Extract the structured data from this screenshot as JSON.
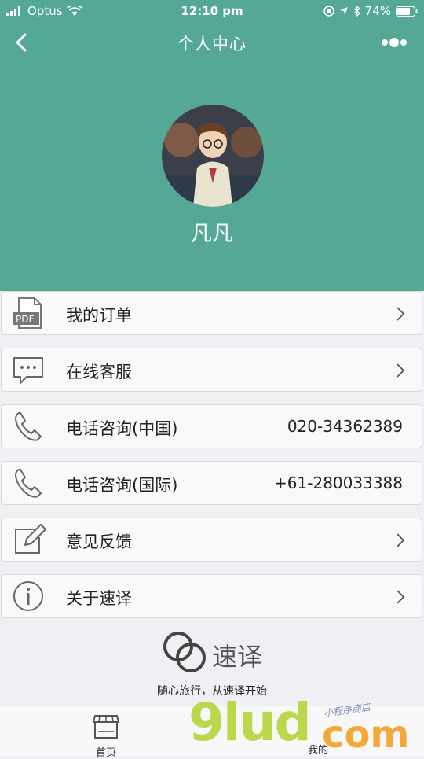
{
  "status_bar": {
    "carrier": "Optus",
    "time": "12:10 pm",
    "battery": "74%"
  },
  "nav": {
    "title": "个人中心"
  },
  "profile": {
    "name": "凡凡"
  },
  "menu": {
    "items": [
      {
        "label": "我的订单",
        "icon": "pdf-document-icon"
      },
      {
        "label": "在线客服",
        "icon": "chat-bubble-icon"
      },
      {
        "label": "电话咨询(中国)",
        "value": "020-34362389",
        "icon": "phone-icon"
      },
      {
        "label": "电话咨询(国际)",
        "value": "+61-280033388",
        "icon": "phone-icon"
      },
      {
        "label": "意见反馈",
        "icon": "edit-icon"
      },
      {
        "label": "关于速译",
        "icon": "info-icon"
      }
    ]
  },
  "brand": {
    "name": "速译",
    "slogan": "随心旅行，从速译开始"
  },
  "tabs": [
    {
      "label": "首页"
    },
    {
      "label": "我的"
    }
  ],
  "watermark": {
    "text_main": "9lud",
    "text_com": "com",
    "text_small": "小程序商店"
  },
  "colors": {
    "header": "#55a895",
    "background": "#efeff4"
  }
}
